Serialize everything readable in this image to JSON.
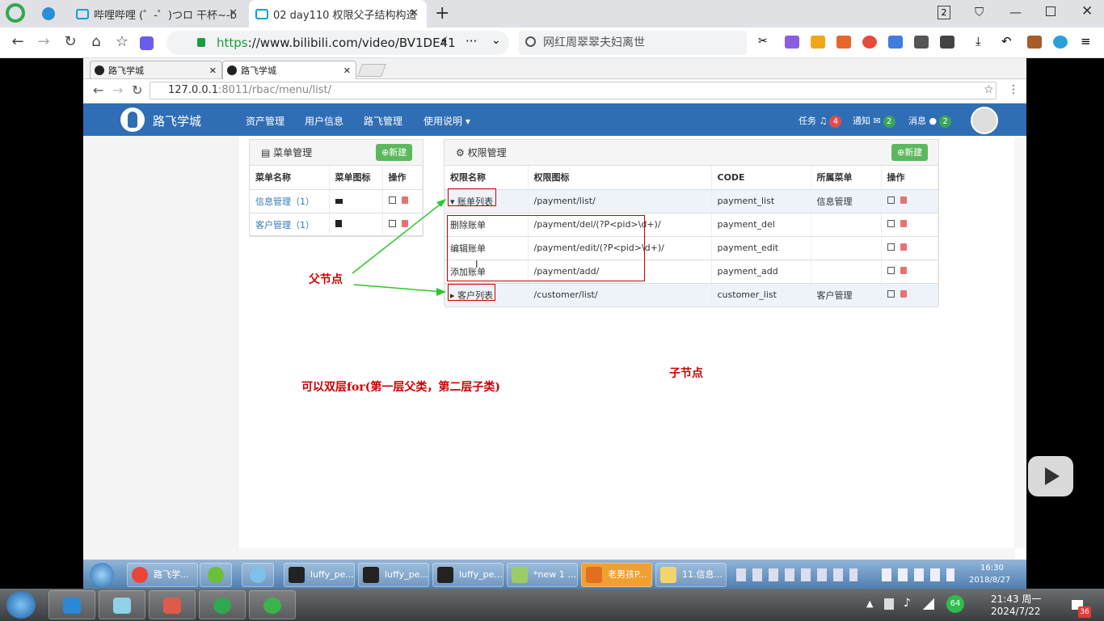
{
  "outer_browser": {
    "tabs": [
      {
        "title": "哔哩哔哩 (゜-゜)つロ 干杯~-b",
        "close": "✕"
      },
      {
        "title": "02 day110 权限父子结构构造",
        "close": "✕"
      }
    ],
    "tab_count": "2",
    "url_scheme": "https",
    "url_rest": "://www.bilibili.com/video/BV1DE41",
    "search_text": "网红周翠翠夫妇离世"
  },
  "inner_browser": {
    "tabs": [
      {
        "title": "路飞学城",
        "close": "✕"
      },
      {
        "title": "路飞学城",
        "close": "✕"
      }
    ],
    "url_host": "127.0.0.1",
    "url_rest": ":8011/rbac/menu/list/"
  },
  "app": {
    "brand": "路飞学城",
    "nav": [
      "资产管理",
      "用户信息",
      "路飞管理",
      "使用说明 ▾"
    ],
    "tasks_label": "任务",
    "tasks_count": "4",
    "notify_label": "通知",
    "notify_count": "2",
    "msg_label": "消息",
    "msg_count": "2",
    "colors": {
      "navbar": "#2f6eb5",
      "badge_red": "#e14d4d",
      "badge_green": "#3aa55a",
      "button_green": "#5cb85c"
    }
  },
  "menu_panel": {
    "title": "菜单管理",
    "new_button": "新建",
    "headers": [
      "菜单名称",
      "菜单图标",
      "操作"
    ],
    "rows": [
      {
        "name": "信息管理（1）",
        "icon": "coffee-icon"
      },
      {
        "name": "客户管理（1）",
        "icon": "copy-icon"
      }
    ]
  },
  "perm_panel": {
    "title": "权限管理",
    "new_button": "新建",
    "headers": [
      "权限名称",
      "权限图标",
      "CODE",
      "所属菜单",
      "操作"
    ],
    "rows": [
      {
        "name": "▾ 账单列表",
        "url": "/payment/list/",
        "code": "payment_list",
        "menu": "信息管理"
      },
      {
        "name": "删除账单",
        "url": "/payment/del/(?P<pid>\\d+)/",
        "code": "payment_del",
        "menu": ""
      },
      {
        "name": "编辑账单",
        "url": "/payment/edit/(?P<pid>\\d+)/",
        "code": "payment_edit",
        "menu": ""
      },
      {
        "name": "添加账单",
        "url": "/payment/add/",
        "code": "payment_add",
        "menu": ""
      },
      {
        "name": "▸ 客户列表",
        "url": "/customer/list/",
        "code": "customer_list",
        "menu": "客户管理"
      }
    ]
  },
  "annotations": {
    "parent_node": "父节点",
    "child_node": "子节点",
    "loop_note": "可以双层for(第一层父类，第二层子类)"
  },
  "inner_taskbar": {
    "items": [
      "路飞学...",
      "luffy_pe...",
      "luffy_pe...",
      "luffy_pe...",
      "*new 1 ...",
      "老男孩P...",
      "11.信息..."
    ],
    "time": "16:30",
    "date": "2018/8/27"
  },
  "windows_taskbar": {
    "time": "21:43 周一",
    "date": "2024/7/22",
    "battery_percent": "64",
    "notification_count": "36"
  }
}
